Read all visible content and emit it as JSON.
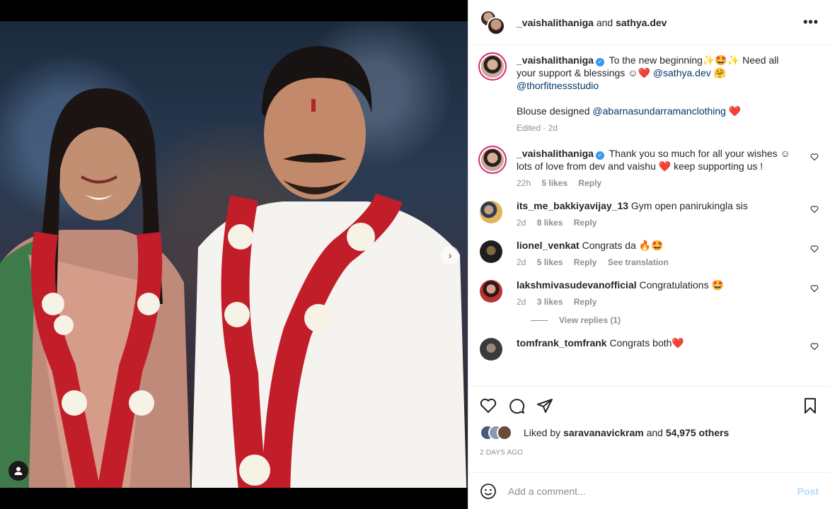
{
  "header": {
    "user1": "_vaishalithaniga",
    "and": "and",
    "user2": "sathya.dev",
    "more_icon": "more-horizontal-icon"
  },
  "caption": {
    "username": "_vaishalithaniga",
    "text_part1": "To the new beginning✨🤩✨ Need all your support & blessings ☺❤️",
    "mention1": "@sathya.dev",
    "emoji_mid": "🤗",
    "mention2": "@thorfitnessstudio",
    "line2_prefix": "Blouse designed",
    "mention3": "@abarnasundarramanclothing",
    "line2_suffix": "❤️",
    "meta": "Edited · 2d"
  },
  "comments": [
    {
      "username": "_vaishalithaniga",
      "verified": true,
      "text": "Thank you so much for all your wishes ☺ lots of love from dev and vaishu ❤️ keep supporting us !",
      "time": "22h",
      "likes": "5 likes",
      "reply": "Reply"
    },
    {
      "username": "its_me_bakkiyavijay_13",
      "text": "Gym open panirukingla sis",
      "time": "2d",
      "likes": "8 likes",
      "reply": "Reply"
    },
    {
      "username": "lionel_venkat",
      "text": "Congrats da 🔥🤩",
      "time": "2d",
      "likes": "5 likes",
      "reply": "Reply",
      "translate": "See translation"
    },
    {
      "username": "lakshmivasudevanofficial",
      "text": "Congratulations 🤩",
      "time": "2d",
      "likes": "3 likes",
      "reply": "Reply",
      "view_replies": "View replies (1)"
    },
    {
      "username": "tomfrank_tomfrank",
      "text": "Congrats both❤️"
    }
  ],
  "likes": {
    "prefix": "Liked by",
    "user": "saravanavickram",
    "and": "and",
    "count": "54,975 others"
  },
  "timestamp": "2 DAYS AGO",
  "add_comment": {
    "placeholder": "Add a comment...",
    "post_label": "Post"
  },
  "colors": {
    "accent": "#3897f0",
    "link": "#00376b",
    "muted": "#8e8e8e",
    "heart": "#ed4956",
    "post_disabled": "#b3dbff"
  }
}
